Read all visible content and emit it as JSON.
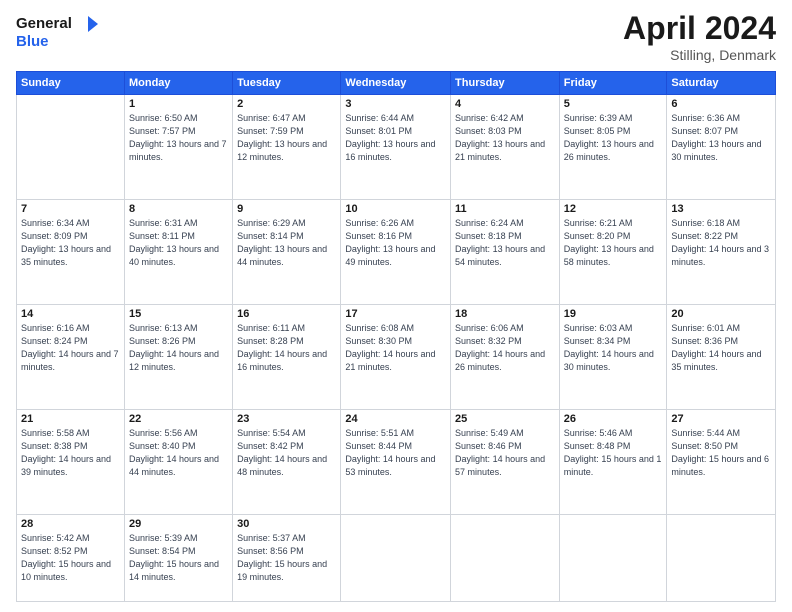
{
  "header": {
    "logo_line1": "General",
    "logo_line2": "Blue",
    "month_title": "April 2024",
    "subtitle": "Stilling, Denmark"
  },
  "weekdays": [
    "Sunday",
    "Monday",
    "Tuesday",
    "Wednesday",
    "Thursday",
    "Friday",
    "Saturday"
  ],
  "weeks": [
    [
      {
        "day": "",
        "sunrise": "",
        "sunset": "",
        "daylight": ""
      },
      {
        "day": "1",
        "sunrise": "Sunrise: 6:50 AM",
        "sunset": "Sunset: 7:57 PM",
        "daylight": "Daylight: 13 hours and 7 minutes."
      },
      {
        "day": "2",
        "sunrise": "Sunrise: 6:47 AM",
        "sunset": "Sunset: 7:59 PM",
        "daylight": "Daylight: 13 hours and 12 minutes."
      },
      {
        "day": "3",
        "sunrise": "Sunrise: 6:44 AM",
        "sunset": "Sunset: 8:01 PM",
        "daylight": "Daylight: 13 hours and 16 minutes."
      },
      {
        "day": "4",
        "sunrise": "Sunrise: 6:42 AM",
        "sunset": "Sunset: 8:03 PM",
        "daylight": "Daylight: 13 hours and 21 minutes."
      },
      {
        "day": "5",
        "sunrise": "Sunrise: 6:39 AM",
        "sunset": "Sunset: 8:05 PM",
        "daylight": "Daylight: 13 hours and 26 minutes."
      },
      {
        "day": "6",
        "sunrise": "Sunrise: 6:36 AM",
        "sunset": "Sunset: 8:07 PM",
        "daylight": "Daylight: 13 hours and 30 minutes."
      }
    ],
    [
      {
        "day": "7",
        "sunrise": "Sunrise: 6:34 AM",
        "sunset": "Sunset: 8:09 PM",
        "daylight": "Daylight: 13 hours and 35 minutes."
      },
      {
        "day": "8",
        "sunrise": "Sunrise: 6:31 AM",
        "sunset": "Sunset: 8:11 PM",
        "daylight": "Daylight: 13 hours and 40 minutes."
      },
      {
        "day": "9",
        "sunrise": "Sunrise: 6:29 AM",
        "sunset": "Sunset: 8:14 PM",
        "daylight": "Daylight: 13 hours and 44 minutes."
      },
      {
        "day": "10",
        "sunrise": "Sunrise: 6:26 AM",
        "sunset": "Sunset: 8:16 PM",
        "daylight": "Daylight: 13 hours and 49 minutes."
      },
      {
        "day": "11",
        "sunrise": "Sunrise: 6:24 AM",
        "sunset": "Sunset: 8:18 PM",
        "daylight": "Daylight: 13 hours and 54 minutes."
      },
      {
        "day": "12",
        "sunrise": "Sunrise: 6:21 AM",
        "sunset": "Sunset: 8:20 PM",
        "daylight": "Daylight: 13 hours and 58 minutes."
      },
      {
        "day": "13",
        "sunrise": "Sunrise: 6:18 AM",
        "sunset": "Sunset: 8:22 PM",
        "daylight": "Daylight: 14 hours and 3 minutes."
      }
    ],
    [
      {
        "day": "14",
        "sunrise": "Sunrise: 6:16 AM",
        "sunset": "Sunset: 8:24 PM",
        "daylight": "Daylight: 14 hours and 7 minutes."
      },
      {
        "day": "15",
        "sunrise": "Sunrise: 6:13 AM",
        "sunset": "Sunset: 8:26 PM",
        "daylight": "Daylight: 14 hours and 12 minutes."
      },
      {
        "day": "16",
        "sunrise": "Sunrise: 6:11 AM",
        "sunset": "Sunset: 8:28 PM",
        "daylight": "Daylight: 14 hours and 16 minutes."
      },
      {
        "day": "17",
        "sunrise": "Sunrise: 6:08 AM",
        "sunset": "Sunset: 8:30 PM",
        "daylight": "Daylight: 14 hours and 21 minutes."
      },
      {
        "day": "18",
        "sunrise": "Sunrise: 6:06 AM",
        "sunset": "Sunset: 8:32 PM",
        "daylight": "Daylight: 14 hours and 26 minutes."
      },
      {
        "day": "19",
        "sunrise": "Sunrise: 6:03 AM",
        "sunset": "Sunset: 8:34 PM",
        "daylight": "Daylight: 14 hours and 30 minutes."
      },
      {
        "day": "20",
        "sunrise": "Sunrise: 6:01 AM",
        "sunset": "Sunset: 8:36 PM",
        "daylight": "Daylight: 14 hours and 35 minutes."
      }
    ],
    [
      {
        "day": "21",
        "sunrise": "Sunrise: 5:58 AM",
        "sunset": "Sunset: 8:38 PM",
        "daylight": "Daylight: 14 hours and 39 minutes."
      },
      {
        "day": "22",
        "sunrise": "Sunrise: 5:56 AM",
        "sunset": "Sunset: 8:40 PM",
        "daylight": "Daylight: 14 hours and 44 minutes."
      },
      {
        "day": "23",
        "sunrise": "Sunrise: 5:54 AM",
        "sunset": "Sunset: 8:42 PM",
        "daylight": "Daylight: 14 hours and 48 minutes."
      },
      {
        "day": "24",
        "sunrise": "Sunrise: 5:51 AM",
        "sunset": "Sunset: 8:44 PM",
        "daylight": "Daylight: 14 hours and 53 minutes."
      },
      {
        "day": "25",
        "sunrise": "Sunrise: 5:49 AM",
        "sunset": "Sunset: 8:46 PM",
        "daylight": "Daylight: 14 hours and 57 minutes."
      },
      {
        "day": "26",
        "sunrise": "Sunrise: 5:46 AM",
        "sunset": "Sunset: 8:48 PM",
        "daylight": "Daylight: 15 hours and 1 minute."
      },
      {
        "day": "27",
        "sunrise": "Sunrise: 5:44 AM",
        "sunset": "Sunset: 8:50 PM",
        "daylight": "Daylight: 15 hours and 6 minutes."
      }
    ],
    [
      {
        "day": "28",
        "sunrise": "Sunrise: 5:42 AM",
        "sunset": "Sunset: 8:52 PM",
        "daylight": "Daylight: 15 hours and 10 minutes."
      },
      {
        "day": "29",
        "sunrise": "Sunrise: 5:39 AM",
        "sunset": "Sunset: 8:54 PM",
        "daylight": "Daylight: 15 hours and 14 minutes."
      },
      {
        "day": "30",
        "sunrise": "Sunrise: 5:37 AM",
        "sunset": "Sunset: 8:56 PM",
        "daylight": "Daylight: 15 hours and 19 minutes."
      },
      {
        "day": "",
        "sunrise": "",
        "sunset": "",
        "daylight": ""
      },
      {
        "day": "",
        "sunrise": "",
        "sunset": "",
        "daylight": ""
      },
      {
        "day": "",
        "sunrise": "",
        "sunset": "",
        "daylight": ""
      },
      {
        "day": "",
        "sunrise": "",
        "sunset": "",
        "daylight": ""
      }
    ]
  ]
}
